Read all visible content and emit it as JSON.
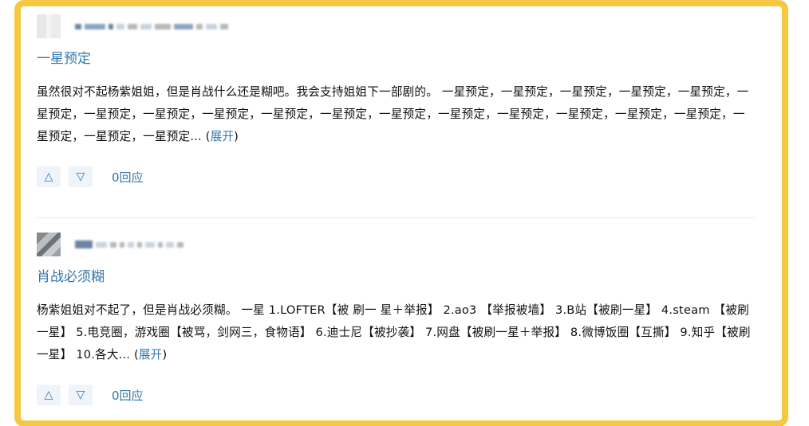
{
  "reviews": [
    {
      "title": "一星预定",
      "body": "虽然很对不起杨紫姐姐，但是肖战什么还是糊吧。我会支持姐姐下一部剧的。 一星预定，一星预定，一星预定，一星预定，一星预定，一星预定，一星预定，一星预定，一星预定，一星预定，一星预定，一星预定，一星预定，一星预定，一星预定，一星预定，一星预定，一星预定，一星预定，一星预定...",
      "expand_open": " (",
      "expand_label": "展开",
      "expand_close": ")",
      "upvote_icon": "△",
      "downvote_icon": "▽",
      "replies": "0回应"
    },
    {
      "title": "肖战必须糊",
      "body": "杨紫姐姐对不起了，但是肖战必须糊。 一星 1.LOFTER【被 刷一 星＋举报】 2.ao3 【举报被墙】 3.B站【被刷一星】 4.steam 【被刷一星】 5.电竞圈，游戏圈【被骂，剑网三，食物语】 6.迪士尼【被抄袭】 7.网盘【被刷一星＋举报】 8.微博饭圈【互撕】 9.知乎【被刷一星】 10.各大...",
      "expand_open": " (",
      "expand_label": "展开",
      "expand_close": ")",
      "upvote_icon": "△",
      "downvote_icon": "▽",
      "replies": "0回应"
    }
  ],
  "colors": {
    "frame": "#f5c842",
    "link": "#3377aa",
    "text": "#111111"
  }
}
